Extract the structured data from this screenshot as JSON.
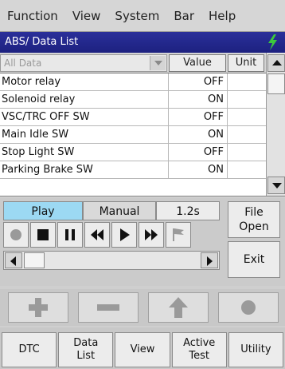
{
  "menu": {
    "items": [
      "Function",
      "View",
      "System",
      "Bar",
      "Help"
    ]
  },
  "title": "ABS/ Data List",
  "table": {
    "filter": "All Data",
    "headers": {
      "value": "Value",
      "unit": "Unit"
    },
    "rows": [
      {
        "name": "Motor relay",
        "value": "OFF",
        "unit": ""
      },
      {
        "name": "Solenoid relay",
        "value": "ON",
        "unit": ""
      },
      {
        "name": "VSC/TRC OFF SW",
        "value": "OFF",
        "unit": ""
      },
      {
        "name": "Main Idle SW",
        "value": "ON",
        "unit": ""
      },
      {
        "name": "Stop Light SW",
        "value": "OFF",
        "unit": ""
      },
      {
        "name": "Parking Brake SW",
        "value": "ON",
        "unit": ""
      }
    ]
  },
  "playback": {
    "tabs": [
      "Play",
      "Manual",
      "1.2s"
    ],
    "file_open": "File Open",
    "exit": "Exit",
    "transport_icons": [
      "record-icon",
      "stop-icon",
      "pause-icon",
      "rewind-icon",
      "play-icon",
      "fast-forward-icon",
      "flag-icon"
    ]
  },
  "actions": {
    "icons": [
      "plus-icon",
      "minus-icon",
      "up-arrow-icon",
      "dot-icon"
    ]
  },
  "bottom_nav": [
    "DTC",
    "Data List",
    "View",
    "Active Test",
    "Utility"
  ],
  "colors": {
    "title_bg": "#1d2180",
    "play_tab": "#9cd9f3",
    "bolt": "#3cc93c"
  }
}
